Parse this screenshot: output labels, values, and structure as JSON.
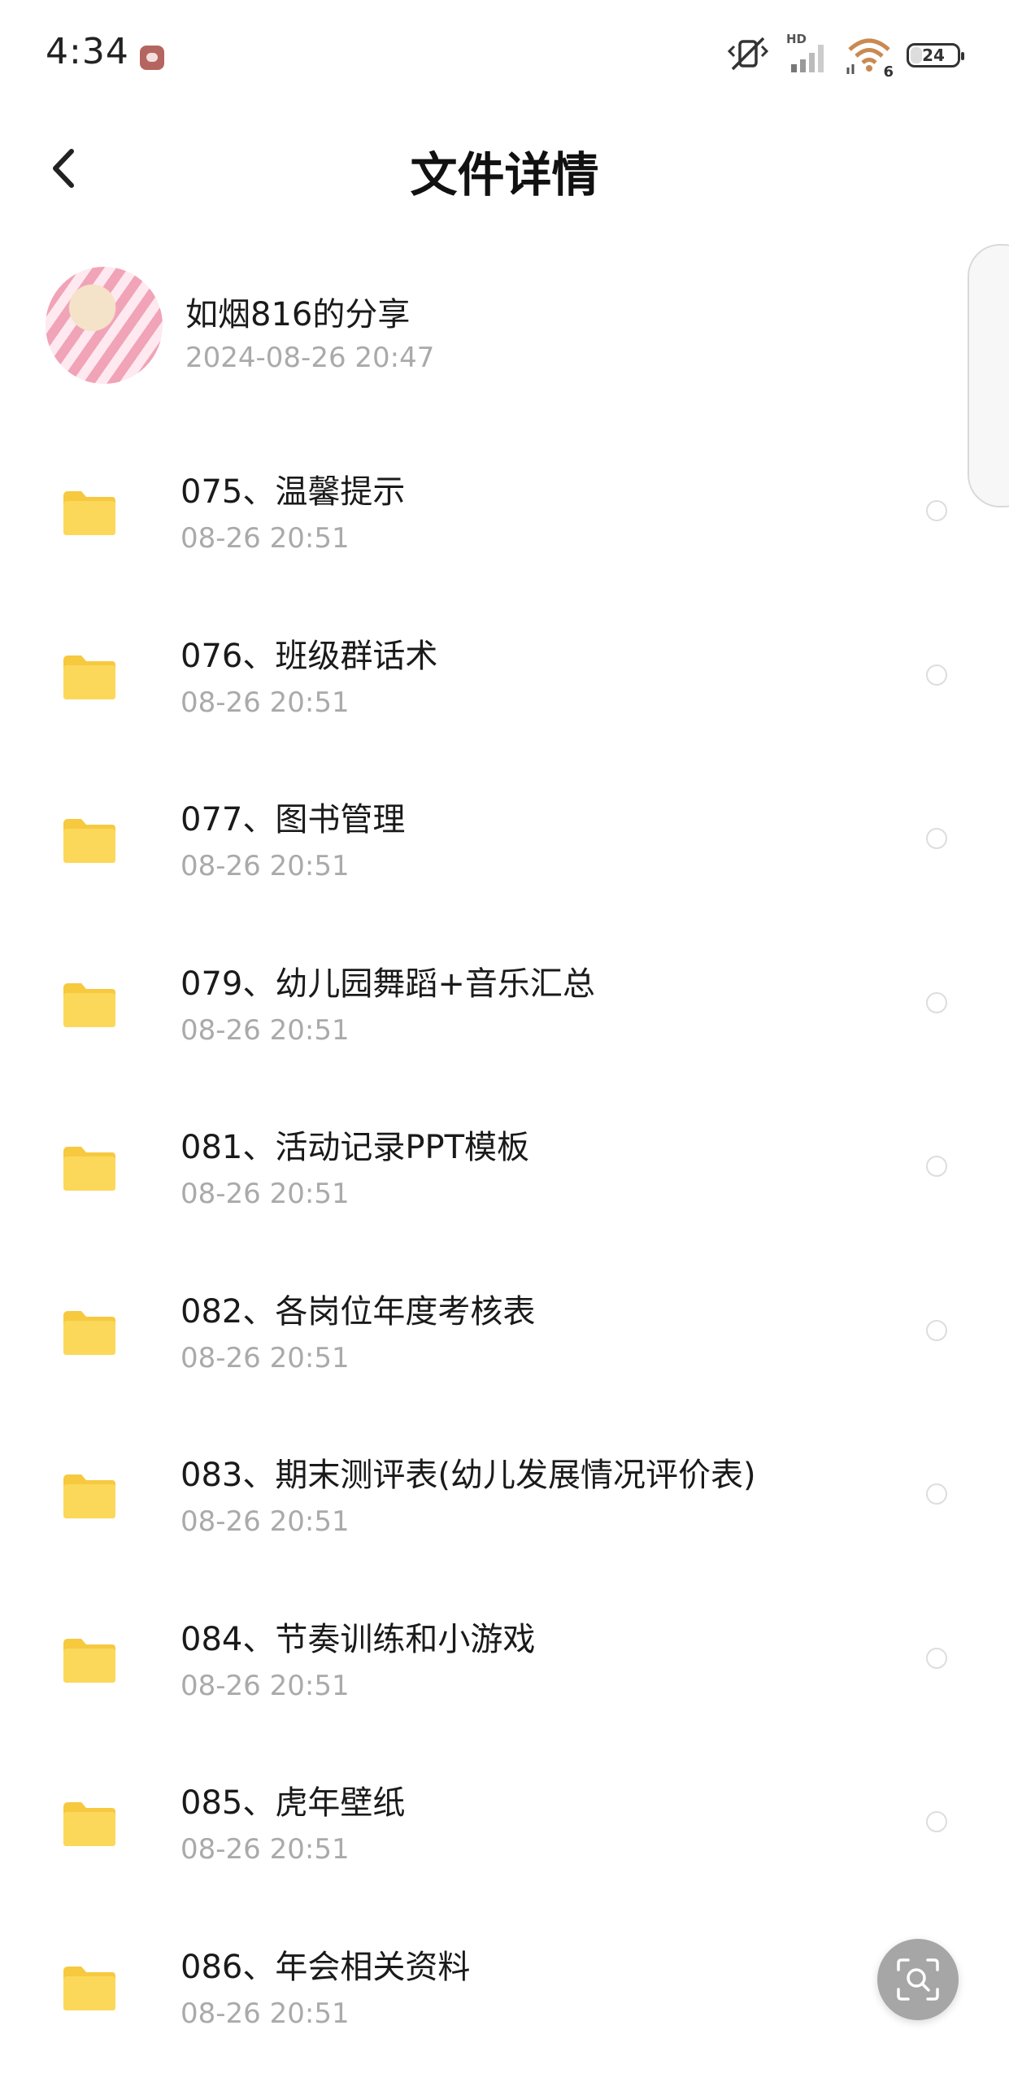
{
  "status_bar": {
    "time": "4:34",
    "hd_label": "HD",
    "wifi_badge": "6",
    "battery": "24",
    "icons": [
      "app-notification-icon",
      "vibrate-off-icon",
      "signal-icon",
      "wifi-icon",
      "battery-icon"
    ]
  },
  "header": {
    "title": "文件详情",
    "back_icon": "chevron-left-icon"
  },
  "share": {
    "sharer": "如烟816的分享",
    "time": "2024-08-26  20:47"
  },
  "files": [
    {
      "name": "075、温馨提示",
      "time": "08-26  20:51"
    },
    {
      "name": "076、班级群话术",
      "time": "08-26  20:51"
    },
    {
      "name": "077、图书管理",
      "time": "08-26  20:51"
    },
    {
      "name": "079、幼儿园舞蹈+音乐汇总",
      "time": "08-26  20:51"
    },
    {
      "name": "081、活动记录PPT模板",
      "time": "08-26  20:51"
    },
    {
      "name": "082、各岗位年度考核表",
      "time": "08-26  20:51"
    },
    {
      "name": "083、期末测评表(幼儿发展情况评价表)",
      "time": "08-26  20:51"
    },
    {
      "name": "084、节奏训练和小游戏",
      "time": "08-26  20:51"
    },
    {
      "name": "085、虎年壁纸",
      "time": "08-26  20:51"
    },
    {
      "name": "086、年会相关资料",
      "time": "08-26  20:51"
    }
  ],
  "colors": {
    "folder": "#fbd85a",
    "folder_tab": "#f6c93f",
    "secondary_text": "#aaaaaa",
    "fab": "#a6a6a6"
  },
  "fab": {
    "icon": "scan-search-icon"
  }
}
